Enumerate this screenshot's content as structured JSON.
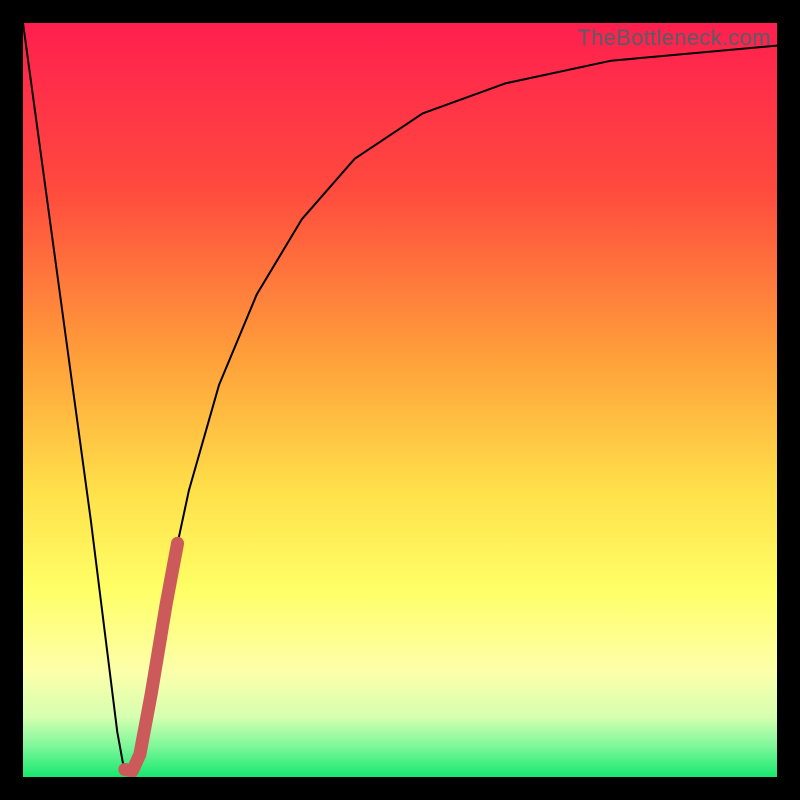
{
  "watermark": "TheBottleneck.com",
  "chart_data": {
    "type": "line",
    "title": "",
    "xlabel": "",
    "ylabel": "",
    "xlim": [
      0,
      100
    ],
    "ylim": [
      0,
      100
    ],
    "gradient_stops": [
      {
        "offset": 0,
        "color": "#ff1f4f"
      },
      {
        "offset": 22,
        "color": "#ff4a3e"
      },
      {
        "offset": 45,
        "color": "#ffa23a"
      },
      {
        "offset": 62,
        "color": "#ffe04a"
      },
      {
        "offset": 75,
        "color": "#ffff66"
      },
      {
        "offset": 86,
        "color": "#fdffaa"
      },
      {
        "offset": 92,
        "color": "#d6ffb0"
      },
      {
        "offset": 96,
        "color": "#7cf79a"
      },
      {
        "offset": 100,
        "color": "#17e86f"
      }
    ],
    "series": [
      {
        "name": "curve-black",
        "stroke": "#000000",
        "stroke_width": 2,
        "points": [
          {
            "x": 0.0,
            "y": 100.0
          },
          {
            "x": 3.0,
            "y": 78.0
          },
          {
            "x": 6.0,
            "y": 56.0
          },
          {
            "x": 9.0,
            "y": 34.0
          },
          {
            "x": 11.0,
            "y": 18.0
          },
          {
            "x": 12.5,
            "y": 6.0
          },
          {
            "x": 13.5,
            "y": 0.5
          },
          {
            "x": 14.5,
            "y": 0.5
          },
          {
            "x": 15.5,
            "y": 4.0
          },
          {
            "x": 17.0,
            "y": 12.0
          },
          {
            "x": 19.0,
            "y": 24.0
          },
          {
            "x": 22.0,
            "y": 38.0
          },
          {
            "x": 26.0,
            "y": 52.0
          },
          {
            "x": 31.0,
            "y": 64.0
          },
          {
            "x": 37.0,
            "y": 74.0
          },
          {
            "x": 44.0,
            "y": 82.0
          },
          {
            "x": 53.0,
            "y": 88.0
          },
          {
            "x": 64.0,
            "y": 92.0
          },
          {
            "x": 78.0,
            "y": 95.0
          },
          {
            "x": 100.0,
            "y": 97.0
          }
        ]
      },
      {
        "name": "highlight-red",
        "stroke": "#cc5a5a",
        "stroke_width": 13,
        "points": [
          {
            "x": 13.5,
            "y": 1.0
          },
          {
            "x": 14.5,
            "y": 0.8
          },
          {
            "x": 15.5,
            "y": 3.0
          },
          {
            "x": 17.0,
            "y": 11.0
          },
          {
            "x": 19.0,
            "y": 23.0
          },
          {
            "x": 20.5,
            "y": 31.0
          }
        ]
      }
    ]
  }
}
